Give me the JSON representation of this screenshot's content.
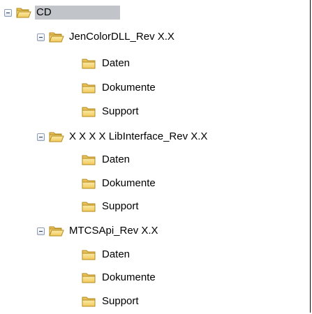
{
  "tree": {
    "root": {
      "label": "CD",
      "expanded": true,
      "selected": true,
      "icon": "folder-open-icon"
    },
    "groups": [
      {
        "label": "JenColorDLL_Rev X.X",
        "expanded": true,
        "icon": "folder-open-icon",
        "children": [
          {
            "label": "Daten",
            "icon": "folder-icon"
          },
          {
            "label": "Dokumente",
            "icon": "folder-icon"
          },
          {
            "label": "Support",
            "icon": "folder-icon"
          }
        ]
      },
      {
        "label": "X X X X  LibInterface_Rev X.X",
        "expanded": true,
        "icon": "folder-open-icon",
        "children": [
          {
            "label": "Daten",
            "icon": "folder-icon"
          },
          {
            "label": "Dokumente",
            "icon": "folder-icon"
          },
          {
            "label": "Support",
            "icon": "folder-icon"
          }
        ]
      },
      {
        "label": "MTCSApi_Rev X.X",
        "expanded": true,
        "icon": "folder-open-icon",
        "children": [
          {
            "label": "Daten",
            "icon": "folder-icon"
          },
          {
            "label": "Dokumente",
            "icon": "folder-icon"
          },
          {
            "label": "Support",
            "icon": "folder-icon"
          }
        ]
      }
    ]
  },
  "colors": {
    "selection": "#c1c4c9",
    "folder_fill": "#f4d46e",
    "folder_edge": "#b58a1c"
  }
}
